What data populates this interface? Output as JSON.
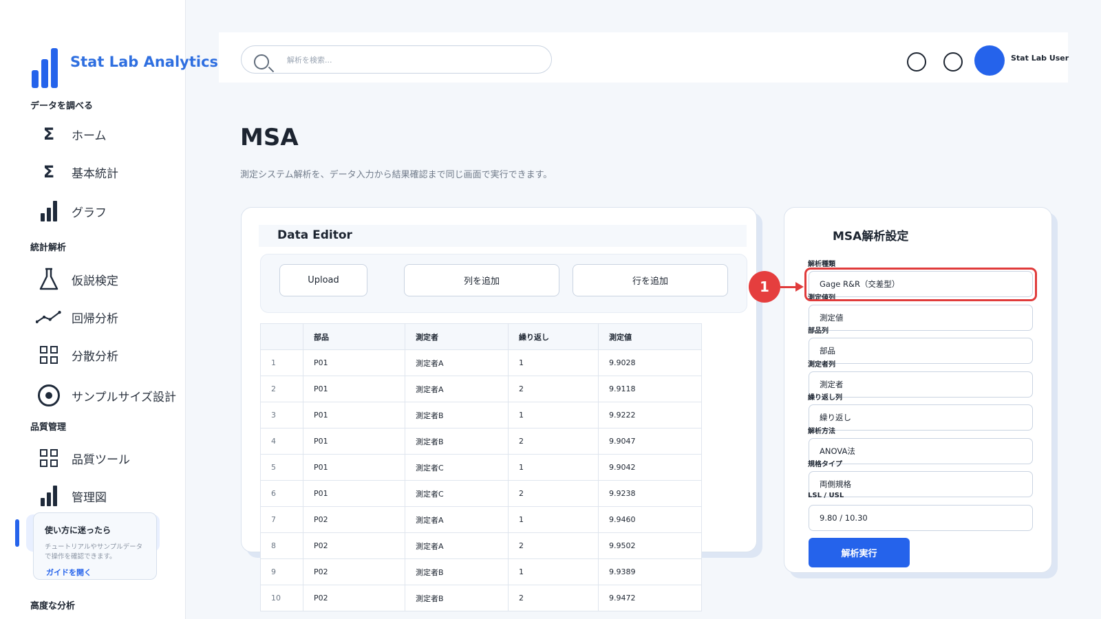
{
  "app": {
    "brand": "Stat Lab Analytics",
    "accent_color": "#2563eb"
  },
  "sidebar": {
    "sections": [
      {
        "label": "データを調べる",
        "items": [
          {
            "label": "ホーム",
            "icon": "sigma-icon"
          },
          {
            "label": "基本統計",
            "icon": "sigma-icon"
          },
          {
            "label": "グラフ",
            "icon": "bar-chart-icon"
          }
        ]
      },
      {
        "label": "統計解析",
        "items": [
          {
            "label": "仮説検定",
            "icon": "flask-icon"
          },
          {
            "label": "回帰分析",
            "icon": "trend-line-icon"
          },
          {
            "label": "分散分析",
            "icon": "grid-icon"
          },
          {
            "label": "サンプルサイズ設計",
            "icon": "target-icon"
          }
        ]
      },
      {
        "label": "品質管理",
        "items": [
          {
            "label": "品質ツール",
            "icon": "grid-icon"
          },
          {
            "label": "管理図",
            "icon": "bar-chart-icon"
          }
        ]
      },
      {
        "label": "高度な分析",
        "items": []
      }
    ],
    "help": {
      "title": "使い方に迷ったら",
      "text": "チュートリアルやサンプルデータで操作を確認できます。",
      "link": "ガイドを開く"
    }
  },
  "header": {
    "search_placeholder": "解析を検索...",
    "user_name": "Stat Lab User"
  },
  "page": {
    "title": "MSA",
    "description": "測定システム解析を、データ入力から結果確認まで同じ画面で実行できます。"
  },
  "editor": {
    "title": "Data Editor",
    "buttons": {
      "upload": "Upload",
      "add_column": "列を追加",
      "add_row": "行を追加"
    },
    "columns": [
      "",
      "部品",
      "測定者",
      "繰り返し",
      "測定値"
    ],
    "rows": [
      [
        "1",
        "P01",
        "測定者A",
        "1",
        "9.9028"
      ],
      [
        "2",
        "P01",
        "測定者A",
        "2",
        "9.9118"
      ],
      [
        "3",
        "P01",
        "測定者B",
        "1",
        "9.9222"
      ],
      [
        "4",
        "P01",
        "測定者B",
        "2",
        "9.9047"
      ],
      [
        "5",
        "P01",
        "測定者C",
        "1",
        "9.9042"
      ],
      [
        "6",
        "P01",
        "測定者C",
        "2",
        "9.9238"
      ],
      [
        "7",
        "P02",
        "測定者A",
        "1",
        "9.9460"
      ],
      [
        "8",
        "P02",
        "測定者A",
        "2",
        "9.9502"
      ],
      [
        "9",
        "P02",
        "測定者B",
        "1",
        "9.9389"
      ],
      [
        "10",
        "P02",
        "測定者B",
        "2",
        "9.9472"
      ]
    ]
  },
  "settings": {
    "title": "MSA解析設定",
    "fields": [
      {
        "label": "解析種類",
        "value": "Gage R&R（交差型）"
      },
      {
        "label": "測定値列",
        "value": "測定値"
      },
      {
        "label": "部品列",
        "value": "部品"
      },
      {
        "label": "測定者列",
        "value": "測定者"
      },
      {
        "label": "繰り返し列",
        "value": "繰り返し"
      },
      {
        "label": "解析方法",
        "value": "ANOVA法"
      },
      {
        "label": "規格タイプ",
        "value": "両側規格"
      },
      {
        "label": "LSL / USL",
        "value": "9.80 / 10.30"
      }
    ],
    "run_label": "解析実行"
  },
  "annotation": {
    "marker": "1",
    "color": "#e03b3b"
  }
}
